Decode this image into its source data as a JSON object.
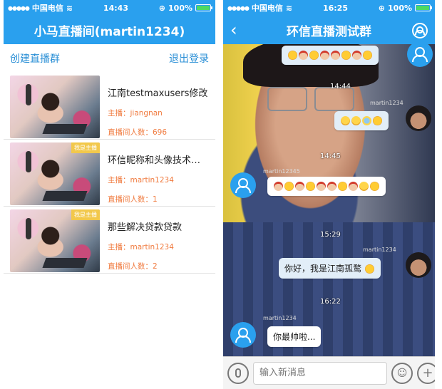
{
  "status_left": {
    "carrier": "中国电信",
    "time": "14:43",
    "battery": "100%"
  },
  "status_right": {
    "carrier": "中国电信",
    "time": "16:25",
    "battery": "100%"
  },
  "room_list": {
    "title": "小马直播间(martin1234)",
    "create_label": "创建直播群",
    "logout_label": "退出登录",
    "rooms": [
      {
        "title": "江南testmaxusers修改",
        "host": "主播：jiangnan",
        "viewers": "直播间人数：696",
        "badge": ""
      },
      {
        "title": "环信昵称和头像技术…",
        "host": "主播：martin1234",
        "viewers": "直播间人数：1",
        "badge": "我是主播"
      },
      {
        "title": "那些解决贷款贷款",
        "host": "主播：martin1234",
        "viewers": "直播间人数：2",
        "badge": "我是主播"
      }
    ]
  },
  "chat": {
    "title": "环信直播测试群",
    "timestamps": [
      "14:44",
      "14:45",
      "15:29",
      "16:22"
    ],
    "usernames": [
      "martin1234",
      "martin12345",
      "martin1234",
      "martin1234",
      "martin1234"
    ],
    "messages": [
      {
        "text": "你好，我是江南孤鹜",
        "side": "right"
      },
      {
        "text": "你最帅啦...",
        "side": "left"
      }
    ],
    "input_placeholder": "输入新消息"
  },
  "colors": {
    "accent": "#2aa0ee",
    "link": "#2a8fd6",
    "meta": "#f07a3e",
    "badge": "#f2c84b"
  }
}
